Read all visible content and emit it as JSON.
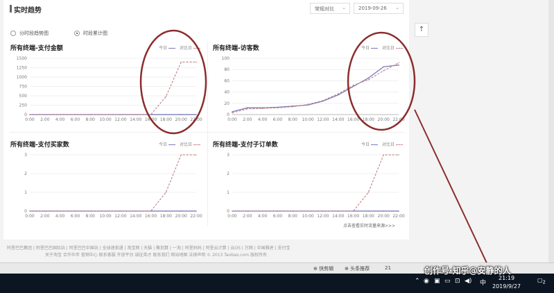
{
  "header": {
    "title": "实时趋势",
    "compare_select": "常规对比",
    "date_select": "2019-09-26"
  },
  "mode": {
    "options": [
      "分时段趋势图",
      "时段累计图"
    ],
    "selected": 1
  },
  "legend": {
    "today": "今日",
    "compare": "对比日"
  },
  "chart_data": [
    {
      "type": "line",
      "title": "所有终端-支付金额",
      "x": [
        "0:00",
        "2:00",
        "4:00",
        "6:00",
        "8:00",
        "10:00",
        "12:00",
        "14:00",
        "16:00",
        "18:00",
        "20:00",
        "22:00"
      ],
      "ylim": [
        0,
        1500
      ],
      "yticks": [
        0,
        250,
        500,
        750,
        1000,
        1250,
        1500
      ],
      "series": [
        {
          "name": "今日",
          "values": [
            0,
            0,
            0,
            0,
            0,
            0,
            0,
            0,
            0,
            0,
            0,
            0
          ]
        },
        {
          "name": "对比日",
          "values": [
            0,
            0,
            0,
            0,
            0,
            0,
            0,
            0,
            0,
            480,
            1400,
            1400
          ]
        }
      ]
    },
    {
      "type": "line",
      "title": "所有终端-访客数",
      "x": [
        "0:00",
        "2:00",
        "4:00",
        "6:00",
        "8:00",
        "10:00",
        "12:00",
        "14:00",
        "16:00",
        "18:00",
        "20:00",
        "22:00"
      ],
      "ylim": [
        0,
        100
      ],
      "yticks": [
        0,
        20,
        40,
        60,
        80,
        100
      ],
      "series": [
        {
          "name": "今日",
          "values": [
            5,
            12,
            12,
            13,
            15,
            17,
            24,
            35,
            50,
            65,
            85,
            88
          ]
        },
        {
          "name": "对比日",
          "values": [
            3,
            10,
            11,
            12,
            14,
            18,
            25,
            37,
            52,
            62,
            78,
            92
          ]
        }
      ]
    },
    {
      "type": "line",
      "title": "所有终端-支付买家数",
      "x": [
        "0:00",
        "2:00",
        "4:00",
        "6:00",
        "8:00",
        "10:00",
        "12:00",
        "14:00",
        "16:00",
        "18:00",
        "20:00",
        "22:00"
      ],
      "ylim": [
        0,
        3
      ],
      "yticks": [
        0,
        1,
        2,
        3
      ],
      "series": [
        {
          "name": "今日",
          "values": [
            0,
            0,
            0,
            0,
            0,
            0,
            0,
            0,
            0,
            0,
            0,
            0
          ]
        },
        {
          "name": "对比日",
          "values": [
            0,
            0,
            0,
            0,
            0,
            0,
            0,
            0,
            0,
            1,
            3,
            3
          ]
        }
      ]
    },
    {
      "type": "line",
      "title": "所有终端-支付子订单数",
      "x": [
        "0:00",
        "2:00",
        "4:00",
        "6:00",
        "8:00",
        "10:00",
        "12:00",
        "14:00",
        "16:00",
        "18:00",
        "20:00",
        "22:00"
      ],
      "ylim": [
        0,
        3
      ],
      "yticks": [
        0,
        1,
        2,
        3
      ],
      "series": [
        {
          "name": "今日",
          "values": [
            0,
            0,
            0,
            0,
            0,
            0,
            0,
            0,
            0,
            0,
            0,
            0
          ]
        },
        {
          "name": "对比日",
          "values": [
            0,
            0,
            0,
            0,
            0,
            0,
            0,
            0,
            0,
            1,
            3,
            3
          ]
        }
      ]
    }
  ],
  "more_link": "点击查看实时流量来源>>>",
  "footer": {
    "row1": "阿里巴巴集团 | 阿里巴巴国际站 | 阿里巴巴中国站 | 全球速卖通 | 淘宝网 | 天猫 | 聚划算 | 一淘 | 阿里妈妈 | 阿里云计算 | 云OS | 万网 | 中国雅虎 | 支付宝",
    "row2": "关于淘宝 合作伙伴 营销中心 联系客服 开放平台 诚征英才 联系我们 网站地图 法律声明 © 2013 Taobao.com 版权所有"
  },
  "statusbar": {
    "item1": "快剪辑",
    "item2": "头条推荐",
    "zoom": "21"
  },
  "taskbar": {
    "ime": "中",
    "time": "21:19",
    "date": "2019/9/27",
    "notif": "2",
    "watermark": "创作号·知乎@安静的人"
  },
  "annotation_color": "#8b2c2c"
}
